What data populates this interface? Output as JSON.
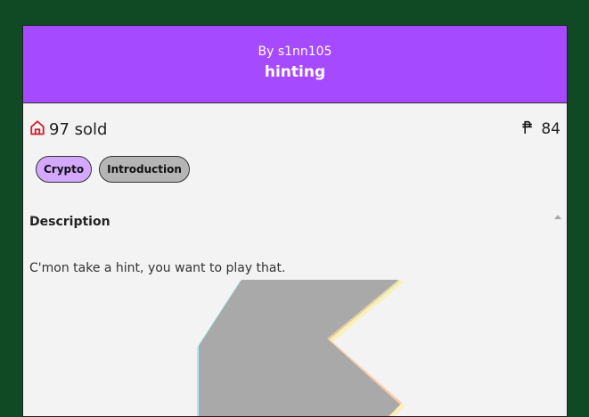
{
  "challenge": {
    "author": "By s1nn105",
    "title": "hinting",
    "sold": "97 sold",
    "points": "84",
    "tags": [
      "Crypto",
      "Introduction"
    ],
    "description_heading": "Description",
    "description_text": "C'mon take a hint, you want to play that."
  },
  "colors": {
    "header": "#a64aff",
    "page_background": "#0f4a24",
    "tag_crypto": "#d4a8ff",
    "tag_intro": "#b5b5b5",
    "home_icon": "#d11a2a"
  },
  "icons": {
    "sold": "home-icon",
    "points": "peso-icon"
  }
}
